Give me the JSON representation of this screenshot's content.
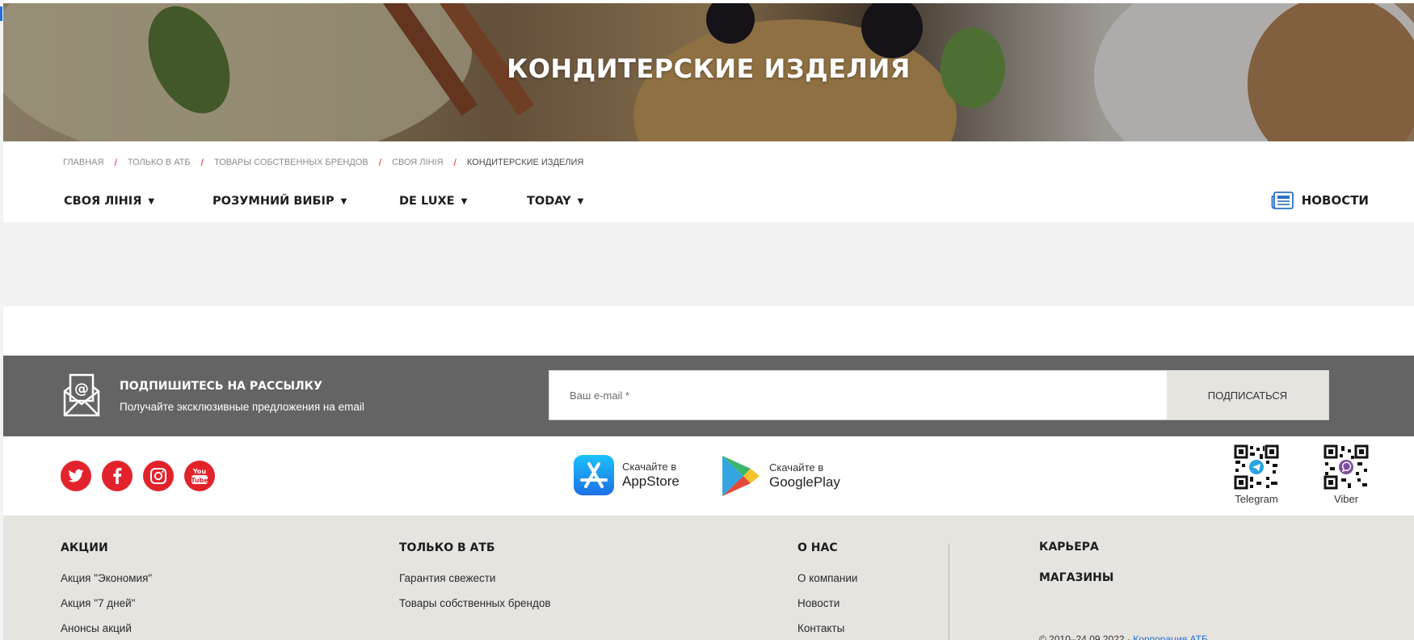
{
  "hero": {
    "title": "КОНДИТЕРСКИЕ ИЗДЕЛИЯ"
  },
  "breadcrumb": [
    {
      "label": "ГЛАВНАЯ"
    },
    {
      "label": "ТОЛЬКО В АТБ"
    },
    {
      "label": "ТОВАРЫ СОБСТВЕННЫХ БРЕНДОВ"
    },
    {
      "label": "СВОЯ ЛІНІЯ"
    },
    {
      "label": "КОНДИТЕРСКИЕ ИЗДЕЛИЯ"
    }
  ],
  "brand_nav": [
    {
      "label": "СВОЯ ЛІНІЯ"
    },
    {
      "label": "РОЗУМНИЙ ВИБІР"
    },
    {
      "label": "DE LUXE"
    },
    {
      "label": "TODAY"
    }
  ],
  "news_link": "НОВОСТИ",
  "newsletter": {
    "title": "ПОДПИШИТЕСЬ НА РАССЫЛКУ",
    "subtitle": "Получайте эксклюзивные предложения на email",
    "placeholder": "Ваш e-mail *",
    "button": "ПОДПИСАТЬСЯ"
  },
  "social": [
    "twitter",
    "facebook",
    "instagram",
    "youtube"
  ],
  "apps": {
    "appstore": {
      "small": "Скачайте в",
      "big": "AppStore"
    },
    "googleplay": {
      "small": "Скачайте в",
      "big": "GooglePlay"
    }
  },
  "qr": {
    "telegram": "Telegram",
    "viber": "Viber"
  },
  "footer": {
    "col1": {
      "head": "АКЦИИ",
      "links": [
        "Акция \"Экономия\"",
        "Акция \"7 дней\"",
        "Анонсы акций"
      ]
    },
    "col2": {
      "head": "ТОЛЬКО В АТБ",
      "links": [
        "Гарантия свежести",
        "Товары собственных брендов"
      ]
    },
    "col3": {
      "head": "О НАС",
      "links": [
        "О компании",
        "Новости",
        "Контакты"
      ]
    },
    "col4": {
      "head1": "КАРЬЕРА",
      "head2": "МАГАЗИНЫ"
    },
    "copyright": {
      "text": "© 2010–24.09.2022 · ",
      "link": "Корпорация АТБ"
    }
  },
  "colors": {
    "accent": "#e2232b",
    "newsletter_bg": "#646464",
    "footer_bg": "#e6e4df",
    "link": "#1e6fd9"
  }
}
